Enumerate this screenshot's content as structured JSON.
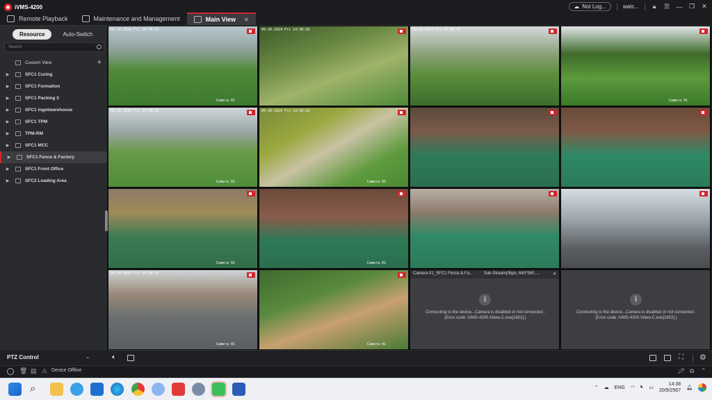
{
  "app": {
    "title": "iVMS-4200",
    "tabs": [
      {
        "label": "Remote Playback"
      },
      {
        "label": "Maintenance and Management"
      },
      {
        "label": "Main View"
      }
    ],
    "user_status": "Not Log...",
    "user_name": "watc..."
  },
  "sidebar": {
    "tab_resource": "Resource",
    "tab_autoswitch": "Auto-Switch",
    "search_placeholder": "Search",
    "custom_view": "Custom View",
    "items": [
      {
        "label": "SFC1 Curing"
      },
      {
        "label": "SFC1 Formation"
      },
      {
        "label": "SFC1 Packing 3"
      },
      {
        "label": "SFC1  ingotwarehouse"
      },
      {
        "label": "SFC1 TPM"
      },
      {
        "label": "TPM-RM"
      },
      {
        "label": "SFC1 MCC"
      },
      {
        "label": "SFC1 Fence & Factory"
      },
      {
        "label": "SFC1 Front Office"
      },
      {
        "label": "SFC2 Loading Area"
      }
    ],
    "ptz_label": "PTZ Control"
  },
  "cells": [
    {
      "osd": "09-20-2024 Fri 14:30:14",
      "cam": "Camera 01"
    },
    {
      "osd": "09-20-2024 Fri 14:30:16",
      "cam": ""
    },
    {
      "osd": "09-20-2024 Fri 14:30:15",
      "cam": ""
    },
    {
      "osd": "",
      "cam": "Camera 01"
    },
    {
      "osd": "09-20-2024 Fri 14:30:15",
      "cam": "Camera 01"
    },
    {
      "osd": "09-20-2024 Fri 14:30:16",
      "cam": "Camera 01"
    },
    {
      "osd": "",
      "cam": ""
    },
    {
      "osd": "",
      "cam": ""
    },
    {
      "osd": "",
      "cam": "Camera 01"
    },
    {
      "osd": "",
      "cam": "Camera 01"
    },
    {
      "osd": "",
      "cam": ""
    },
    {
      "osd": "",
      "cam": ""
    },
    {
      "osd": "09-20-2024 Fri 14:30:15",
      "cam": "Camera 01"
    },
    {
      "osd": "",
      "cam": "Camera 01"
    }
  ],
  "offline": {
    "header": "Camera 01_SFC1 Fence & Fa...",
    "stream": "Sub-Stream(0bps, 640*360, ...",
    "message": "Connecting to the device...Camera is disabled or not connected .(Error code: iVMS-4200.Video.C.exe[1602].)"
  },
  "status": {
    "device_offline": "Device Offline"
  },
  "taskbar": {
    "lang": "ENG",
    "time": "14:38",
    "date": "20/9/2567"
  }
}
